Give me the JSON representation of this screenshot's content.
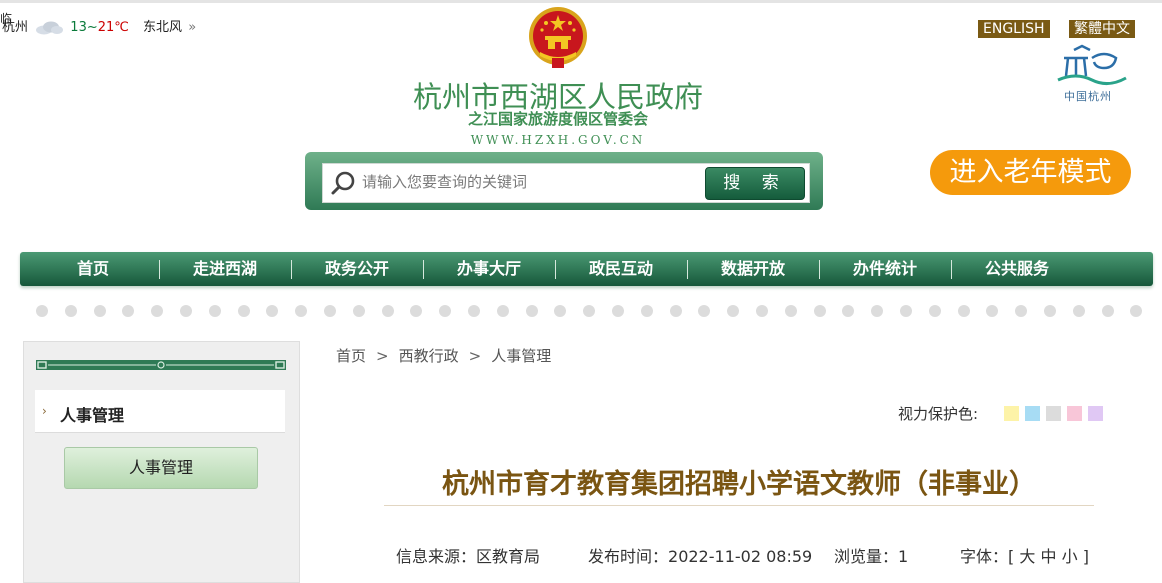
{
  "weather": {
    "clipped_char": "临",
    "city": "杭州",
    "icon": "cloud-icon",
    "temp_low": "13~",
    "temp_high": "21℃",
    "wind": "东北风",
    "more": "»"
  },
  "header": {
    "title": "杭州市西湖区人民政府",
    "subtitle": "之江国家旅游度假区管委会",
    "url": "WWW.HZXH.GOV.CN",
    "lang_english": "ENGLISH",
    "lang_traditional": "繁體中文",
    "hz_logo_text": "中国杭州",
    "elder_mode": "进入老年模式"
  },
  "search": {
    "placeholder": "请输入您要查询的关键词",
    "button": "搜 索"
  },
  "nav": {
    "items": [
      "首页",
      "走进西湖",
      "政务公开",
      "办事大厅",
      "政民互动",
      "数据开放",
      "办件统计",
      "公共服务"
    ]
  },
  "sidebar": {
    "heading": "人事管理",
    "button": "人事管理"
  },
  "breadcrumb": {
    "items": [
      "首页",
      "西教行政",
      "人事管理"
    ],
    "sep": ">"
  },
  "vision": {
    "label": "视力保护色:",
    "colors": [
      "#fdf3a8",
      "#a7dcf4",
      "#dcdcdc",
      "#f8c6d8",
      "#e0c8f4"
    ]
  },
  "article": {
    "title": "杭州市育才教育集团招聘小学语文教师（非事业）",
    "source_label": "信息来源：",
    "source": "区教育局",
    "time_label": "发布时间：",
    "time": "2022-11-02 08:59",
    "views_label": "浏览量：",
    "views": "1",
    "font_label": "字体：",
    "font_open": "[",
    "font_large": "大",
    "font_medium": "中",
    "font_small": "小",
    "font_close": "]"
  },
  "colors": {
    "brand_green": "#3f8f54",
    "nav_green": "#16573a",
    "title_brown": "#7a5512",
    "elder_orange": "#f59a0c",
    "lang_brown": "#7a5a14"
  }
}
